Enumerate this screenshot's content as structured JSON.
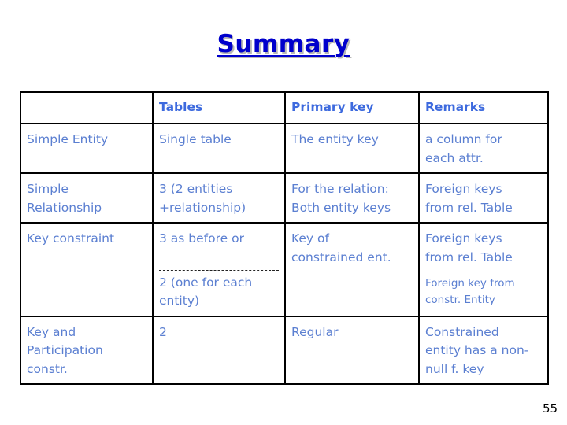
{
  "slide": {
    "title": "Summary",
    "number": "55",
    "title_color": "#0000CC",
    "header_text_color": "#3D6ADE",
    "body_text_color": "#5B7FD1",
    "border_color": "#000000",
    "background": "#ffffff"
  },
  "table": {
    "headers": [
      "",
      "Tables",
      "Primary key",
      "Remarks"
    ],
    "rows": [
      {
        "label": "Simple Entity",
        "tables": [
          "Single table"
        ],
        "primary_key": [
          "The entity key"
        ],
        "remarks": [
          "a column for",
          "each attr."
        ]
      },
      {
        "label": "Simple Relationship",
        "label_lines": [
          "Simple",
          "Relationship"
        ],
        "tables": [
          "3 (2 entities",
          "+relationship)"
        ],
        "primary_key": [
          "For the relation:",
          "Both entity keys"
        ],
        "remarks": [
          "Foreign keys",
          "from rel. Table"
        ]
      },
      {
        "label": "Key constraint",
        "tables_top": [
          "3 as before or"
        ],
        "tables_bottom": [
          "2 (one for each",
          "entity)"
        ],
        "primary_key_top": [
          "Key of",
          "constrained ent."
        ],
        "primary_key_bottom": [],
        "remarks_top": [
          "Foreign keys",
          "from rel. Table"
        ],
        "remarks_bottom": [
          "Foreign key from",
          "constr. Entity"
        ],
        "has_dashed_separator": true
      },
      {
        "label": "Key and Participation constr.",
        "label_lines": [
          "Key and",
          "Participation",
          "constr."
        ],
        "tables": [
          "2"
        ],
        "primary_key": [
          "Regular"
        ],
        "remarks": [
          "Constrained",
          "entity has a non-",
          "null f. key"
        ]
      }
    ]
  }
}
